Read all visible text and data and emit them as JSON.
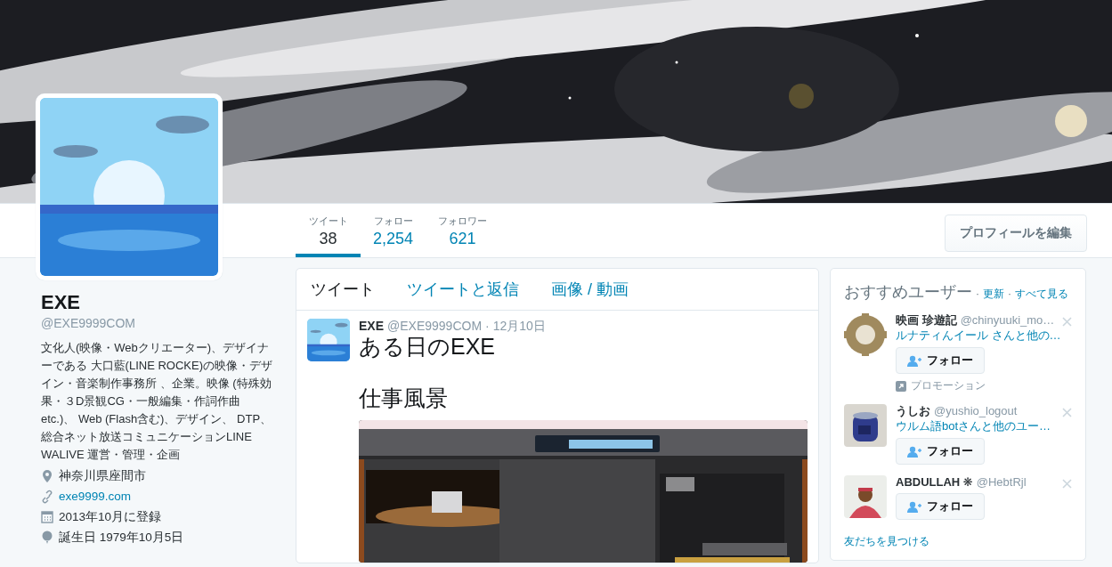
{
  "banner": {
    "kind": "picture"
  },
  "profile": {
    "avatar": {
      "kind": "picture"
    },
    "name": "EXE",
    "handle": "@EXE9999COM",
    "bio": "文化人(映像・Webクリエーター)、デザイナーである 大口藍(LINE ROCKE)の映像・デザイン・音楽制作事務所 、企業。映像 (特殊効果・３D景観CG・一般編集・作詞作曲 etc.)、 Web (Flash含む)、デザイン、 DTP、総合ネット放送コミュニケーションLINE WALIVE 運営・管理・企画",
    "details": [
      {
        "kind": "location",
        "text": "神奈川県座間市"
      },
      {
        "kind": "link",
        "text": "exe9999.com"
      },
      {
        "kind": "joined",
        "text": "2013年10月に登録"
      },
      {
        "kind": "birthday",
        "text": "誕生日 1979年10月5日"
      }
    ]
  },
  "stats": [
    {
      "label": "ツイート",
      "value": "38",
      "selected": true
    },
    {
      "label": "フォロー",
      "value": "2,254",
      "selected": false
    },
    {
      "label": "フォロワー",
      "value": "621",
      "selected": false
    }
  ],
  "edit_profile_button": "プロフィールを編集",
  "timeline": {
    "tabs": [
      {
        "label": "ツイート",
        "selected": true
      },
      {
        "label": "ツイートと返信",
        "selected": false
      },
      {
        "label": "画像 / 動画",
        "selected": false
      }
    ],
    "tweets": [
      {
        "avatar": {
          "kind": "picture"
        },
        "name": "EXE",
        "handle": "@EXE9999COM",
        "separator": "·",
        "time": "12月10日",
        "paragraphs": [
          "ある日のEXE",
          "仕事風景"
        ],
        "media": {
          "kind": "picture"
        }
      }
    ]
  },
  "suggestions": {
    "title": "おすすめユーザー",
    "links": [
      {
        "separator": "·",
        "label": "更新"
      },
      {
        "separator": "·",
        "label": "すべて見る"
      }
    ],
    "users": [
      {
        "name": "映画 珍遊記",
        "handle": "@chinyuuki_mo…",
        "context": "ルナティんイール さんと他の…",
        "follow": "フォロー",
        "promoted": "プロモーション"
      },
      {
        "name": "うしお",
        "handle": "@yushio_logout",
        "context": "ウルム語botさんと他のユー…",
        "follow": "フォロー"
      },
      {
        "name": "ABDULLAH ❋",
        "handle": "@HebtRjl",
        "follow": "フォロー"
      }
    ],
    "footer": "友だちを見つける"
  }
}
